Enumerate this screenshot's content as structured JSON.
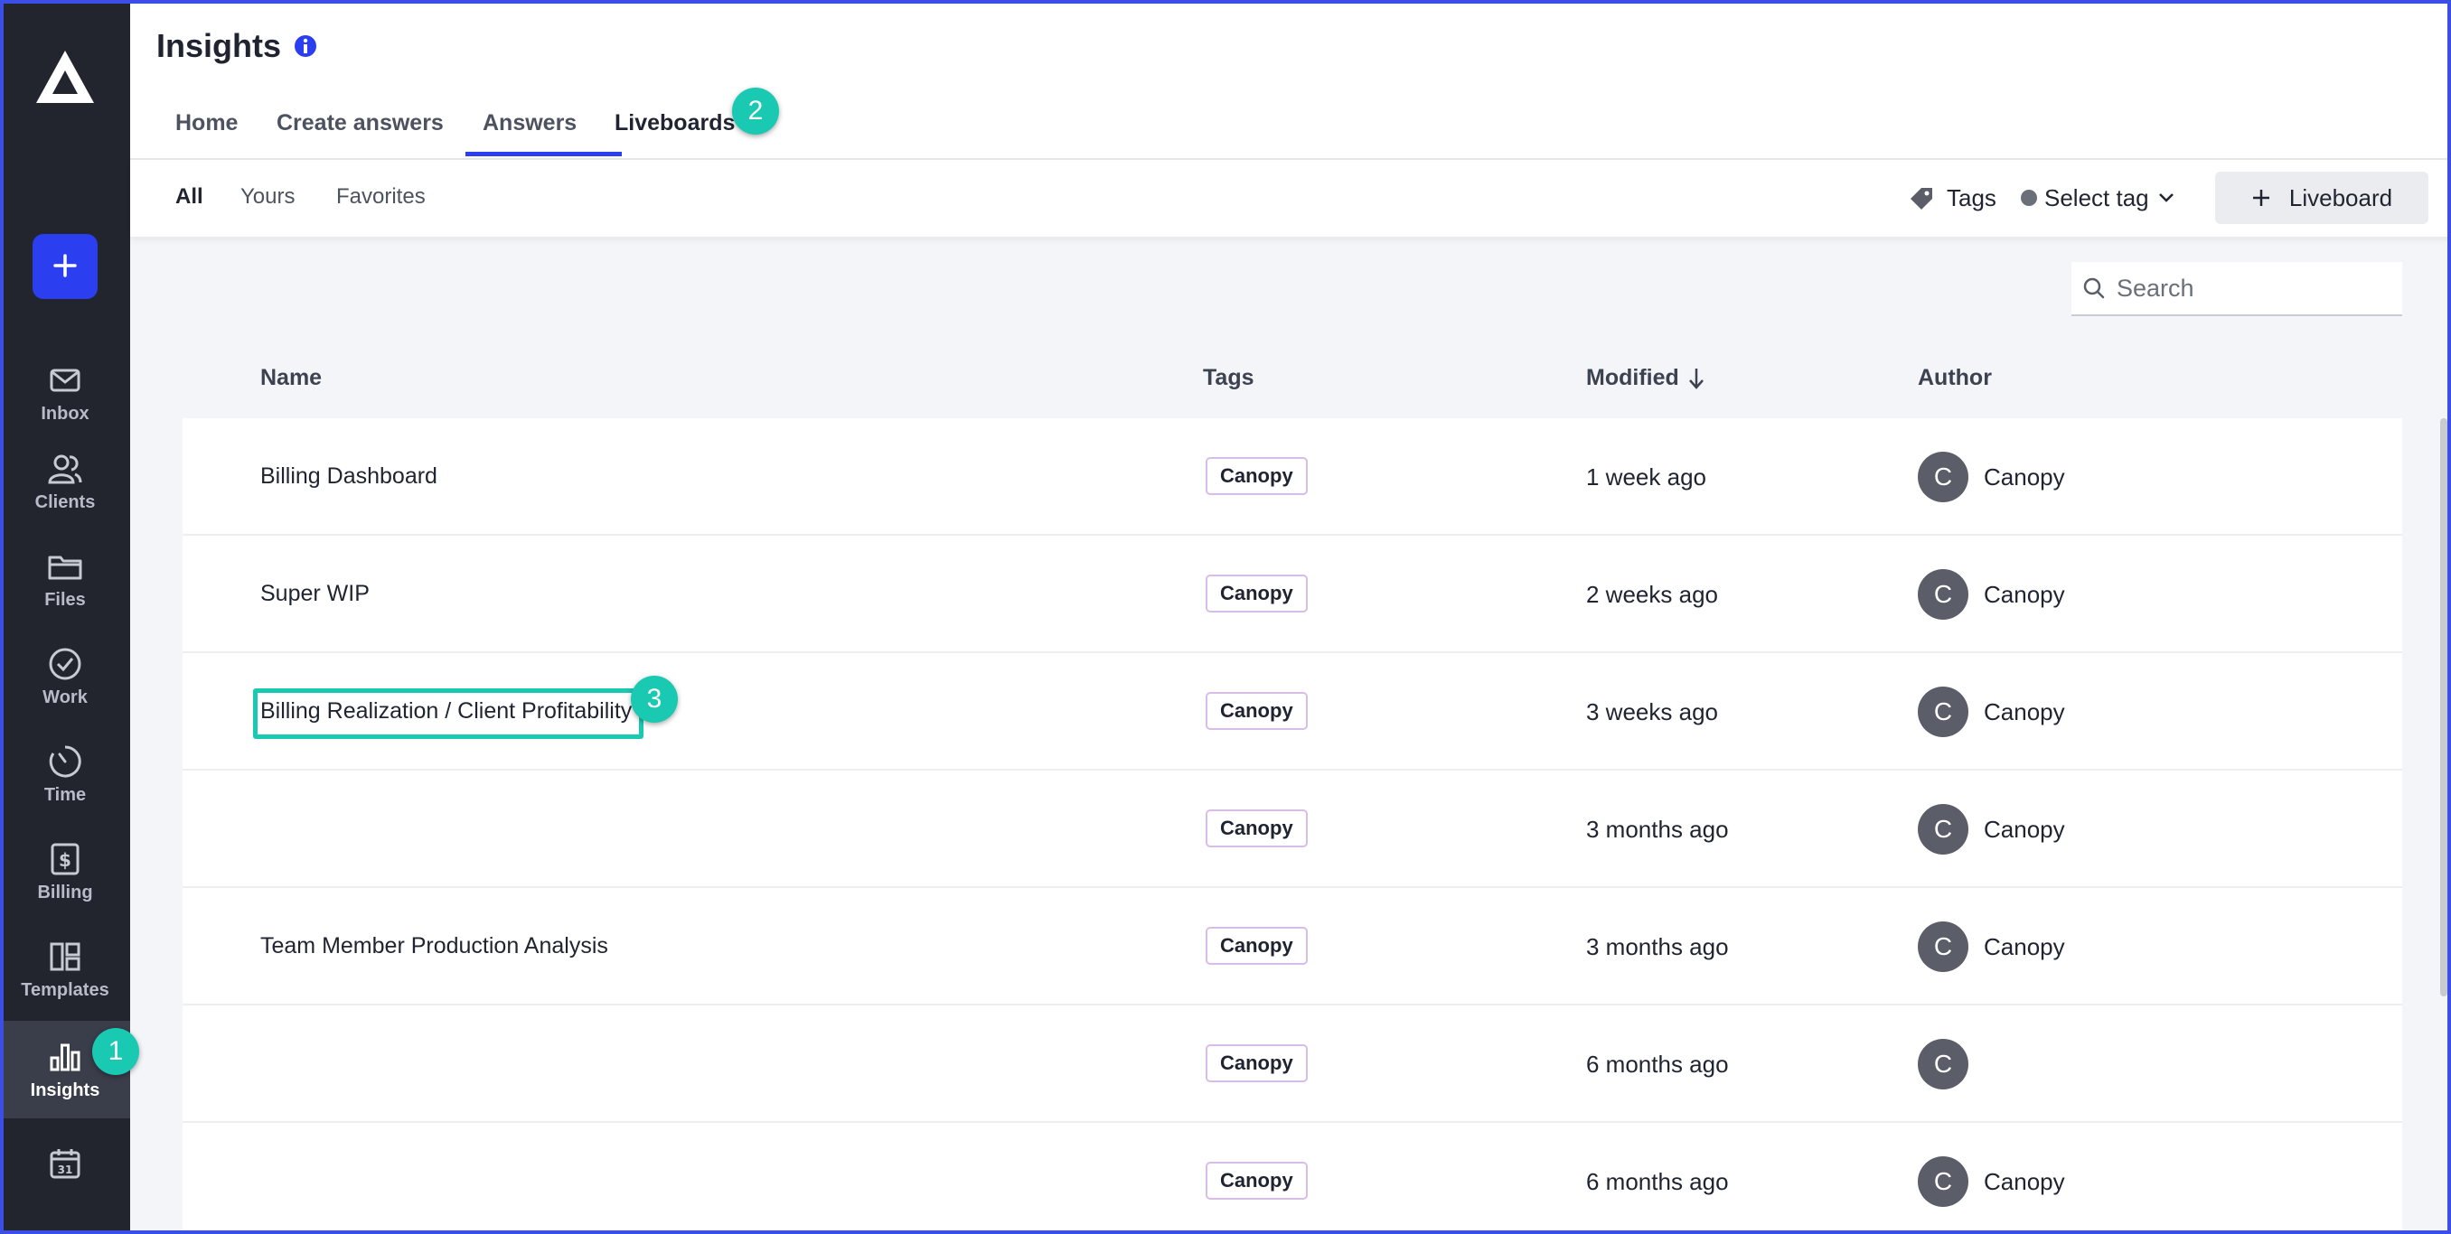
{
  "app": {
    "title": "Insights",
    "accent_color": "#2b3ef0",
    "highlight_color": "#19c9b1"
  },
  "sidebar": {
    "logo": "canopy-logo",
    "add_button_icon": "plus-icon",
    "items": [
      {
        "label": "Inbox",
        "icon": "mail-icon"
      },
      {
        "label": "Clients",
        "icon": "users-icon"
      },
      {
        "label": "Files",
        "icon": "folder-icon"
      },
      {
        "label": "Work",
        "icon": "check-circle-icon"
      },
      {
        "label": "Time",
        "icon": "timer-icon"
      },
      {
        "label": "Billing",
        "icon": "dollar-icon"
      },
      {
        "label": "Templates",
        "icon": "layout-icon"
      },
      {
        "label": "Insights",
        "icon": "bar-chart-icon",
        "active": true
      },
      {
        "label": "",
        "icon": "calendar-icon"
      }
    ]
  },
  "tabs": [
    {
      "label": "Home"
    },
    {
      "label": "Create answers"
    },
    {
      "label": "Answers"
    },
    {
      "label": "Liveboards",
      "active": true
    }
  ],
  "filters": [
    {
      "label": "All",
      "active": true
    },
    {
      "label": "Yours"
    },
    {
      "label": "Favorites"
    }
  ],
  "toolbar": {
    "tags_label": "Tags",
    "select_tag_label": "Select tag",
    "new_liveboard_label": "Liveboard"
  },
  "search": {
    "placeholder": "Search",
    "value": ""
  },
  "table": {
    "columns": {
      "name": "Name",
      "tags": "Tags",
      "modified": "Modified",
      "author": "Author"
    },
    "rows": [
      {
        "name": "Billing Dashboard",
        "tag": "Canopy",
        "modified": "1 week ago",
        "avatar": "C",
        "author": "Canopy"
      },
      {
        "name": "Super WIP",
        "tag": "Canopy",
        "modified": "2 weeks ago",
        "avatar": "C",
        "author": "Canopy"
      },
      {
        "name": "Billing Realization / Client Profitability",
        "tag": "Canopy",
        "modified": "3 weeks ago",
        "avatar": "C",
        "author": "Canopy"
      },
      {
        "name": "",
        "tag": "Canopy",
        "modified": "3 months ago",
        "avatar": "C",
        "author": "Canopy"
      },
      {
        "name": "Team Member Production Analysis",
        "tag": "Canopy",
        "modified": "3 months ago",
        "avatar": "C",
        "author": "Canopy"
      },
      {
        "name": "",
        "tag": "Canopy",
        "modified": "6 months ago",
        "avatar": "C",
        "author": ""
      },
      {
        "name": "",
        "tag": "Canopy",
        "modified": "6 months ago",
        "avatar": "C",
        "author": "Canopy"
      }
    ]
  },
  "annotations": {
    "step1": "1",
    "step2": "2",
    "step3": "3"
  }
}
